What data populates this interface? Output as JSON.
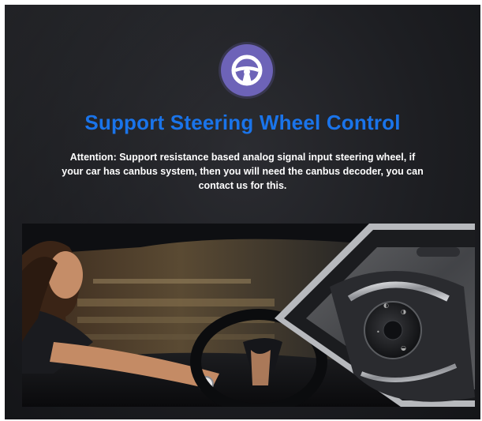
{
  "banner": {
    "icon": "steering-wheel-icon",
    "headline": "Support Steering Wheel Control",
    "attention_text": "Attention: Support resistance based analog signal input steering wheel, if your car has canbus system, then you will need the canbus decoder, you can contact us for this.",
    "colors": {
      "background": "#1d1e22",
      "headline": "#1a74ea",
      "badge": "#6d63b8"
    }
  },
  "photo": {
    "subject": "woman-driving-photo",
    "inset": "steering-wheel-buttons-closeup"
  }
}
